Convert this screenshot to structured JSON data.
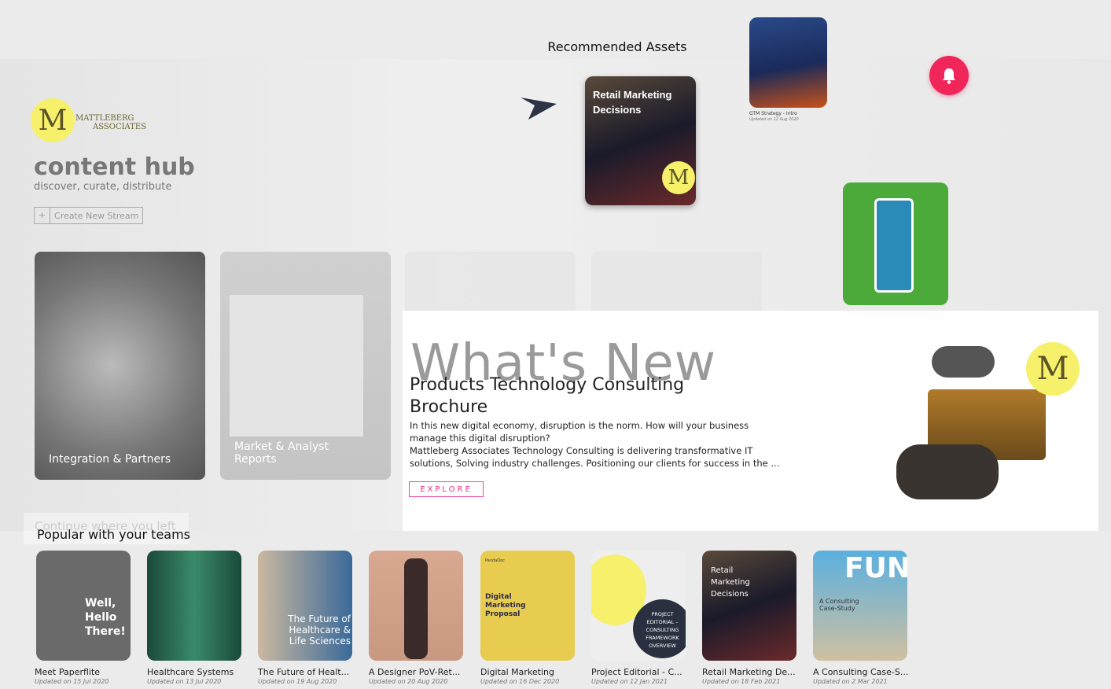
{
  "brand": {
    "logo_letter": "M",
    "logo_line1": "MATTLEBERG",
    "logo_line2": "ASSOCIATES",
    "title": "content hub",
    "subtitle": "discover, curate, distribute",
    "create_button": "Create New Stream",
    "create_icon": "plus-icon"
  },
  "streams": [
    {
      "label": "Integration & Partners"
    },
    {
      "label": "Market & Analyst Reports"
    },
    {
      "label": ""
    },
    {
      "label": ""
    }
  ],
  "recommended": {
    "title": "Recommended Assets",
    "arrow_icon": "send-arrow-icon",
    "featured": {
      "overlay": "Retail Marketing Decisions",
      "logo_letter": "M"
    },
    "gtm": {
      "title": "GTM Strategy - Intro",
      "date": "Updated on 12 Aug 2020"
    }
  },
  "notification": {
    "icon": "bell-icon",
    "color": "#f0265a"
  },
  "whats_new": {
    "heading": "What's New",
    "title": "Products Technology Consulting Brochure",
    "desc1": "In this new digital economy, disruption is the norm. How will your business manage this digital disruption?",
    "desc2": "Mattleberg Associates Technology Consulting is delivering transformative IT solutions, Solving industry challenges. Positioning our clients for success in the ...",
    "button": "EXPLORE",
    "logo_letter": "M",
    "accent": "#e8318a"
  },
  "continue_label": "Continue where you left",
  "popular": {
    "title": "Popular with your teams",
    "items": [
      {
        "title": "Meet Paperflite",
        "date": "Updated on 15 Jul 2020",
        "overlay": "Well, Hello There!"
      },
      {
        "title": "Healthcare Systems",
        "date": "Updated on 13 Jul 2020",
        "overlay": ""
      },
      {
        "title": "The Future of Healt...",
        "date": "Updated on 19 Aug 2020",
        "overlay": "The Future of Healthcare & Life Sciences"
      },
      {
        "title": "A Designer PoV-Ret...",
        "date": "Updated on 20 Aug 2020",
        "overlay": ""
      },
      {
        "title": "Digital Marketing",
        "date": "Updated on 16 Dec 2020",
        "overlay": "Digital Marketing Proposal",
        "brand": "PandaDoc"
      },
      {
        "title": "Project Editorial - C...",
        "date": "Updated on 12 Jan 2021",
        "overlay": "PROJECT EDITORIAL – CONSULTING FRAMEWORK OVERVIEW"
      },
      {
        "title": "Retail Marketing De...",
        "date": "Updated on 18 Feb 2021",
        "overlay": "Retail Marketing Decisions"
      },
      {
        "title": "A Consulting Case-S...",
        "date": "Updated on 2 Mar 2021",
        "overlay": "A Consulting Case-Study",
        "brand": "FUN"
      }
    ]
  }
}
